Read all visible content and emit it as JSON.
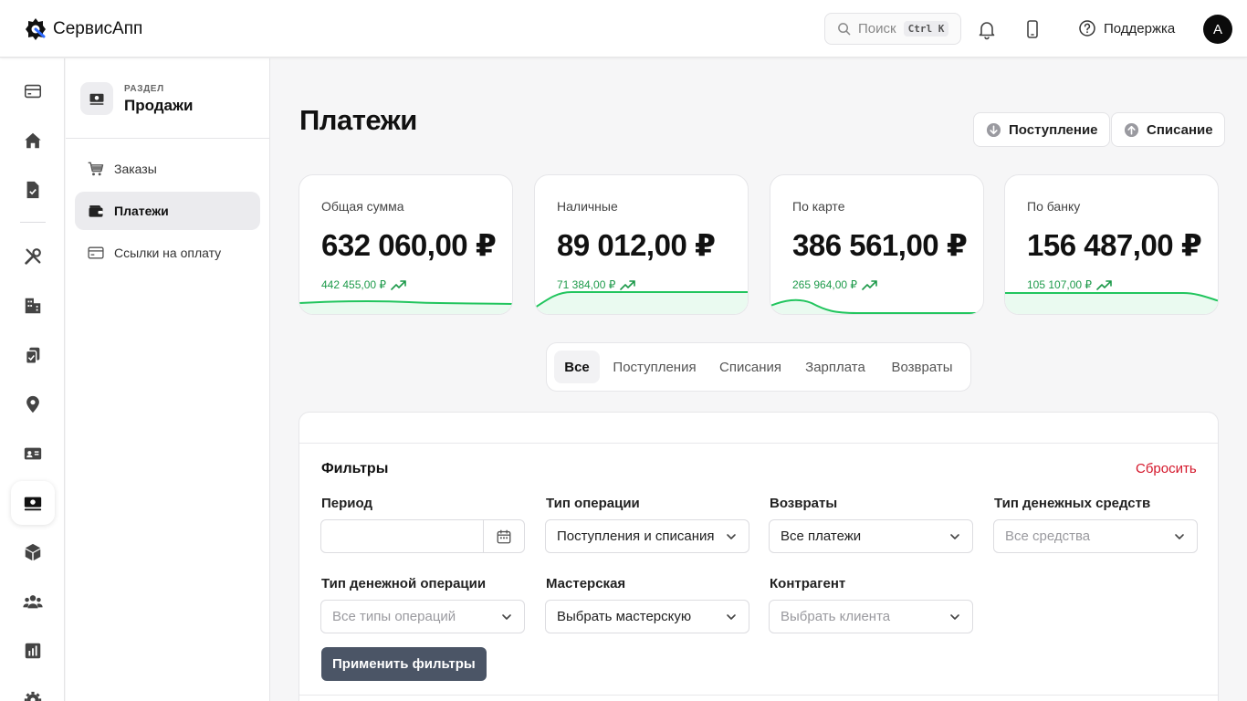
{
  "app": {
    "name": "СервисАпп"
  },
  "header": {
    "search_placeholder": "Поиск",
    "search_shortcut": "Ctrl K",
    "support_label": "Поддержка",
    "avatar_initial": "A"
  },
  "rail": {
    "items": [
      {
        "icon": "credit-card-icon"
      },
      {
        "icon": "home-icon"
      },
      {
        "icon": "document-check-icon"
      },
      {
        "icon": "tools-icon"
      },
      {
        "icon": "building-icon"
      },
      {
        "icon": "clipboard-copy-icon"
      },
      {
        "icon": "location-pin-icon"
      },
      {
        "icon": "id-card-icon"
      },
      {
        "icon": "cash-icon",
        "active": true
      },
      {
        "icon": "cube-icon"
      },
      {
        "icon": "users-icon"
      },
      {
        "icon": "chart-icon"
      },
      {
        "icon": "settings-icon"
      }
    ]
  },
  "sidebar": {
    "kicker": "РАЗДЕЛ",
    "title": "Продажи",
    "items": [
      {
        "label": "Заказы",
        "icon": "cart-icon"
      },
      {
        "label": "Платежи",
        "icon": "wallet-icon",
        "active": true
      },
      {
        "label": "Ссылки на оплату",
        "icon": "payment-link-icon"
      }
    ]
  },
  "page": {
    "title": "Платежи",
    "income_button": "Поступление",
    "expense_button": "Списание"
  },
  "stats": [
    {
      "label": "Общая сумма",
      "value": "632 060,00 ₽",
      "sub": "442 455,00 ₽",
      "trend": "up"
    },
    {
      "label": "Наличные",
      "value": "89 012,00 ₽",
      "sub": "71 384,00 ₽",
      "trend": "up"
    },
    {
      "label": "По карте",
      "value": "386 561,00 ₽",
      "sub": "265 964,00 ₽",
      "trend": "up"
    },
    {
      "label": "По банку",
      "value": "156 487,00 ₽",
      "sub": "105 107,00 ₽",
      "trend": "up"
    }
  ],
  "tabs": [
    {
      "label": "Все",
      "active": true
    },
    {
      "label": "Поступления"
    },
    {
      "label": "Списания"
    },
    {
      "label": "Зарплата"
    },
    {
      "label": "Возвраты"
    }
  ],
  "filters": {
    "title": "Фильтры",
    "reset_label": "Сбросить",
    "period": {
      "label": "Период",
      "value": ""
    },
    "operation_type": {
      "label": "Тип операции",
      "value": "Поступления и списания"
    },
    "returns": {
      "label": "Возвраты",
      "value": "Все платежи"
    },
    "funds_type": {
      "label": "Тип денежных средств",
      "placeholder": "Все средства"
    },
    "money_operation_type": {
      "label": "Тип денежной операции",
      "placeholder": "Все типы операций"
    },
    "workshop": {
      "label": "Мастерская",
      "value": "Выбрать мастерскую"
    },
    "counterparty": {
      "label": "Контрагент",
      "placeholder": "Выбрать клиента"
    },
    "apply_label": "Применить фильтры"
  },
  "colors": {
    "accent_green": "#1d9a4a",
    "reset_red": "#d4162a",
    "apply_bg": "#4b5566"
  }
}
